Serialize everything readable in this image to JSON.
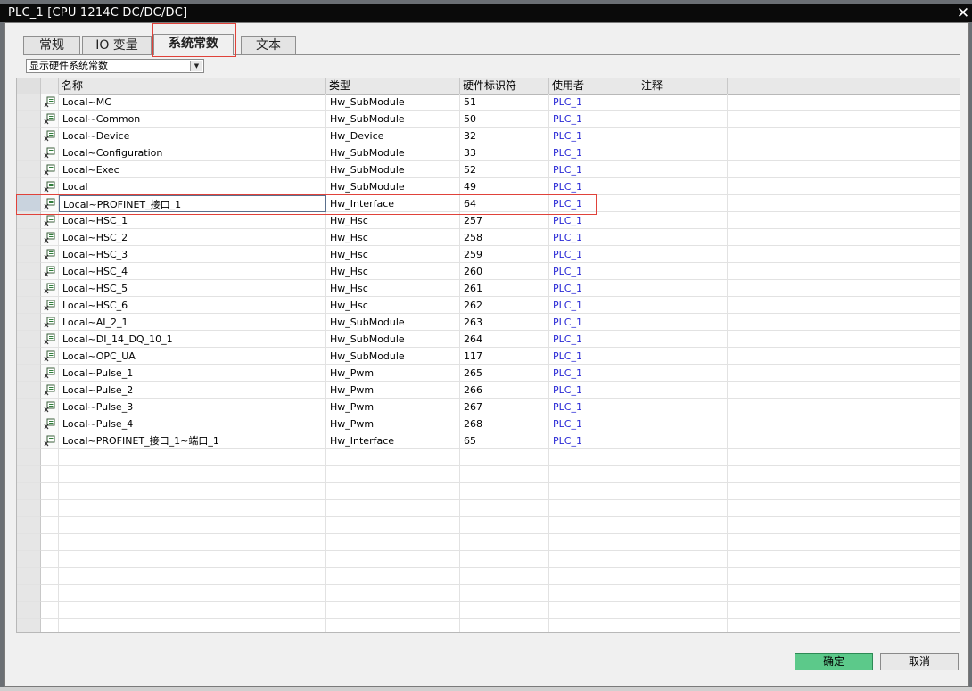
{
  "window": {
    "title": "PLC_1 [CPU 1214C DC/DC/DC]",
    "close_glyph": "✕"
  },
  "tabs": [
    {
      "label": "常规"
    },
    {
      "label": "IO 变量"
    },
    {
      "label": "系统常数"
    },
    {
      "label": "文本"
    }
  ],
  "filter": {
    "selected": "显示硬件系统常数",
    "arrow_glyph": "▼"
  },
  "table": {
    "columns": [
      "名称",
      "类型",
      "硬件标识符",
      "使用者",
      "注释"
    ],
    "rows": [
      {
        "name": "Local~MC",
        "type": "Hw_SubModule",
        "id": "51",
        "user": "PLC_1",
        "note": ""
      },
      {
        "name": "Local~Common",
        "type": "Hw_SubModule",
        "id": "50",
        "user": "PLC_1",
        "note": ""
      },
      {
        "name": "Local~Device",
        "type": "Hw_Device",
        "id": "32",
        "user": "PLC_1",
        "note": ""
      },
      {
        "name": "Local~Configuration",
        "type": "Hw_SubModule",
        "id": "33",
        "user": "PLC_1",
        "note": ""
      },
      {
        "name": "Local~Exec",
        "type": "Hw_SubModule",
        "id": "52",
        "user": "PLC_1",
        "note": ""
      },
      {
        "name": "Local",
        "type": "Hw_SubModule",
        "id": "49",
        "user": "PLC_1",
        "note": ""
      },
      {
        "name": "Local~PROFINET_接口_1",
        "type": "Hw_Interface",
        "id": "64",
        "user": "PLC_1",
        "note": ""
      },
      {
        "name": "Local~HSC_1",
        "type": "Hw_Hsc",
        "id": "257",
        "user": "PLC_1",
        "note": ""
      },
      {
        "name": "Local~HSC_2",
        "type": "Hw_Hsc",
        "id": "258",
        "user": "PLC_1",
        "note": ""
      },
      {
        "name": "Local~HSC_3",
        "type": "Hw_Hsc",
        "id": "259",
        "user": "PLC_1",
        "note": ""
      },
      {
        "name": "Local~HSC_4",
        "type": "Hw_Hsc",
        "id": "260",
        "user": "PLC_1",
        "note": ""
      },
      {
        "name": "Local~HSC_5",
        "type": "Hw_Hsc",
        "id": "261",
        "user": "PLC_1",
        "note": ""
      },
      {
        "name": "Local~HSC_6",
        "type": "Hw_Hsc",
        "id": "262",
        "user": "PLC_1",
        "note": ""
      },
      {
        "name": "Local~AI_2_1",
        "type": "Hw_SubModule",
        "id": "263",
        "user": "PLC_1",
        "note": ""
      },
      {
        "name": "Local~DI_14_DQ_10_1",
        "type": "Hw_SubModule",
        "id": "264",
        "user": "PLC_1",
        "note": ""
      },
      {
        "name": "Local~OPC_UA",
        "type": "Hw_SubModule",
        "id": "117",
        "user": "PLC_1",
        "note": ""
      },
      {
        "name": "Local~Pulse_1",
        "type": "Hw_Pwm",
        "id": "265",
        "user": "PLC_1",
        "note": ""
      },
      {
        "name": "Local~Pulse_2",
        "type": "Hw_Pwm",
        "id": "266",
        "user": "PLC_1",
        "note": ""
      },
      {
        "name": "Local~Pulse_3",
        "type": "Hw_Pwm",
        "id": "267",
        "user": "PLC_1",
        "note": ""
      },
      {
        "name": "Local~Pulse_4",
        "type": "Hw_Pwm",
        "id": "268",
        "user": "PLC_1",
        "note": ""
      },
      {
        "name": "Local~PROFINET_接口_1~端口_1",
        "type": "Hw_Interface",
        "id": "65",
        "user": "PLC_1",
        "note": ""
      }
    ],
    "selected_row_index": 6,
    "row_icon": "system-constant-icon"
  },
  "buttons": {
    "ok_label": "确定",
    "cancel_label": "取消"
  },
  "colors": {
    "highlight_box": "#e0423a",
    "user_link": "#2a2ad6",
    "ok_button": "#5cc98a"
  }
}
